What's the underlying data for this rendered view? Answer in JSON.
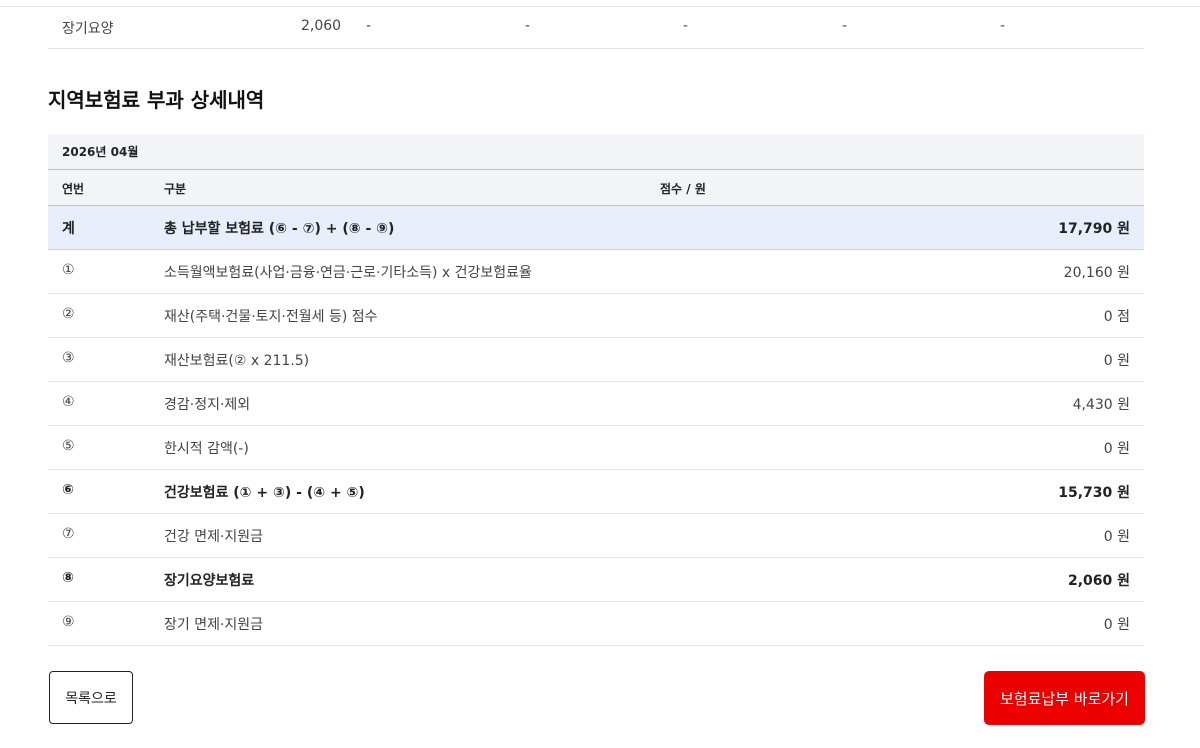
{
  "top_row": {
    "label": "장기요양",
    "amount": "2,060",
    "dashes": [
      "-",
      "-",
      "-",
      "-",
      "-"
    ]
  },
  "section_title": "지역보험료 부과 상세내역",
  "period": "2026년 04월",
  "table_headers": {
    "seq": "연번",
    "category": "구분",
    "points_won": "점수 / 원"
  },
  "rows": [
    {
      "num": "계",
      "label": "총 납부할 보험료 (⑥ - ⑦) + (⑧ - ⑨)",
      "value": "17,790 원"
    },
    {
      "num": "①",
      "label": "소득월액보험료(사업·금융·연금·근로·기타소득) x 건강보험료율",
      "value": "20,160 원"
    },
    {
      "num": "②",
      "label": "재산(주택·건물·토지·전월세 등) 점수",
      "value": "0 점"
    },
    {
      "num": "③",
      "label": "재산보험료(② x 211.5)",
      "value": "0 원"
    },
    {
      "num": "④",
      "label": "경감·정지·제외",
      "value": "4,430 원"
    },
    {
      "num": "⑤",
      "label": "한시적 감액(-)",
      "value": "0 원"
    },
    {
      "num": "⑥",
      "label": "건강보험료 (① + ③) - (④ + ⑤)",
      "value": "15,730 원"
    },
    {
      "num": "⑦",
      "label": "건강 면제·지원금",
      "value": "0 원"
    },
    {
      "num": "⑧",
      "label": "장기요양보험료",
      "value": "2,060 원"
    },
    {
      "num": "⑨",
      "label": "장기 면제·지원금",
      "value": "0 원"
    }
  ],
  "buttons": {
    "list": "목록으로",
    "pay": "보험료납부 바로가기"
  },
  "colors": {
    "accent_red": "#ec0000",
    "total_row_bg": "#e8effb",
    "header_bg": "#f2f4f8"
  }
}
